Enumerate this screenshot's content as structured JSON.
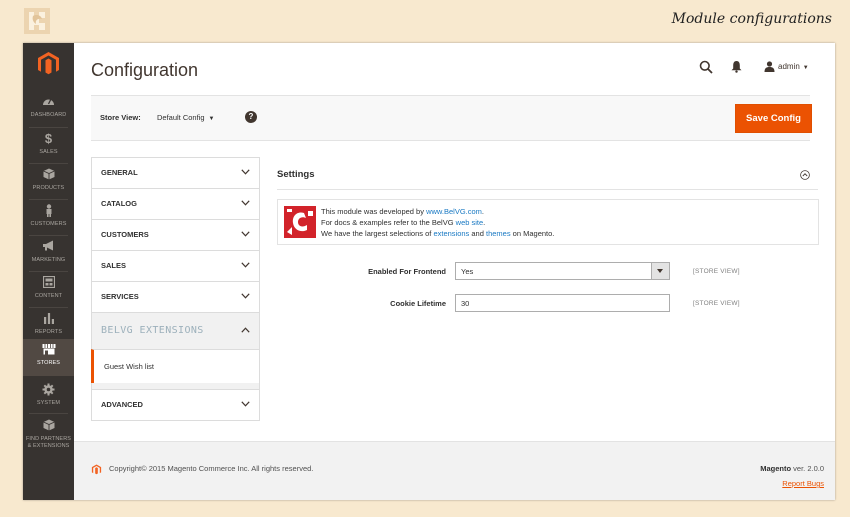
{
  "caption": "Module configurations",
  "colors": {
    "accent": "#eb5202",
    "nav_bg": "#373330",
    "link": "#1979c3",
    "belvg_red": "#d2232a"
  },
  "nav": {
    "items": [
      {
        "label": "DASHBOARD",
        "icon": "dashboard-icon"
      },
      {
        "label": "SALES",
        "icon": "dollar-icon"
      },
      {
        "label": "PRODUCTS",
        "icon": "box-icon"
      },
      {
        "label": "CUSTOMERS",
        "icon": "person-icon"
      },
      {
        "label": "MARKETING",
        "icon": "megaphone-icon"
      },
      {
        "label": "CONTENT",
        "icon": "content-icon"
      },
      {
        "label": "REPORTS",
        "icon": "bar-chart-icon"
      },
      {
        "label": "STORES",
        "icon": "store-icon"
      },
      {
        "label": "SYSTEM",
        "icon": "gear-icon"
      },
      {
        "label_line1": "FIND PARTNERS",
        "label_line2": "& EXTENSIONS",
        "icon": "cube-icon"
      }
    ]
  },
  "header": {
    "title": "Configuration",
    "user": "admin"
  },
  "store_view": {
    "label": "Store View:",
    "value": "Default Config",
    "help": "?"
  },
  "save_button": "Save Config",
  "tabs": {
    "general": "GENERAL",
    "catalog": "CATALOG",
    "customers": "CUSTOMERS",
    "sales": "SALES",
    "services": "SERVICES",
    "belvg": "BELVG EXTENSIONS",
    "guest_wishlist": "Guest Wish list",
    "advanced": "ADVANCED"
  },
  "settings": {
    "title": "Settings",
    "info": {
      "l1_pre": "This module was developed by ",
      "l1_link": "www.BelVG.com",
      "l1_post": ".",
      "l2_pre": "For docs & examples refer to the BelVG ",
      "l2_link": "web site",
      "l2_post": ".",
      "l3_pre": "We have the largest selections of ",
      "l3_link1": "extensions",
      "l3_mid": " and ",
      "l3_link2": "themes",
      "l3_post": " on Magento."
    },
    "fields": {
      "enabled_label": "Enabled For Frontend",
      "enabled_value": "Yes",
      "enabled_scope": "[STORE VIEW]",
      "cookie_label": "Cookie Lifetime",
      "cookie_value": "30",
      "cookie_scope": "[STORE VIEW]"
    }
  },
  "footer": {
    "copyright": "Copyright© 2015 Magento Commerce Inc. All rights reserved.",
    "brand": "Magento",
    "version": " ver. 2.0.0",
    "report": "Report Bugs"
  }
}
